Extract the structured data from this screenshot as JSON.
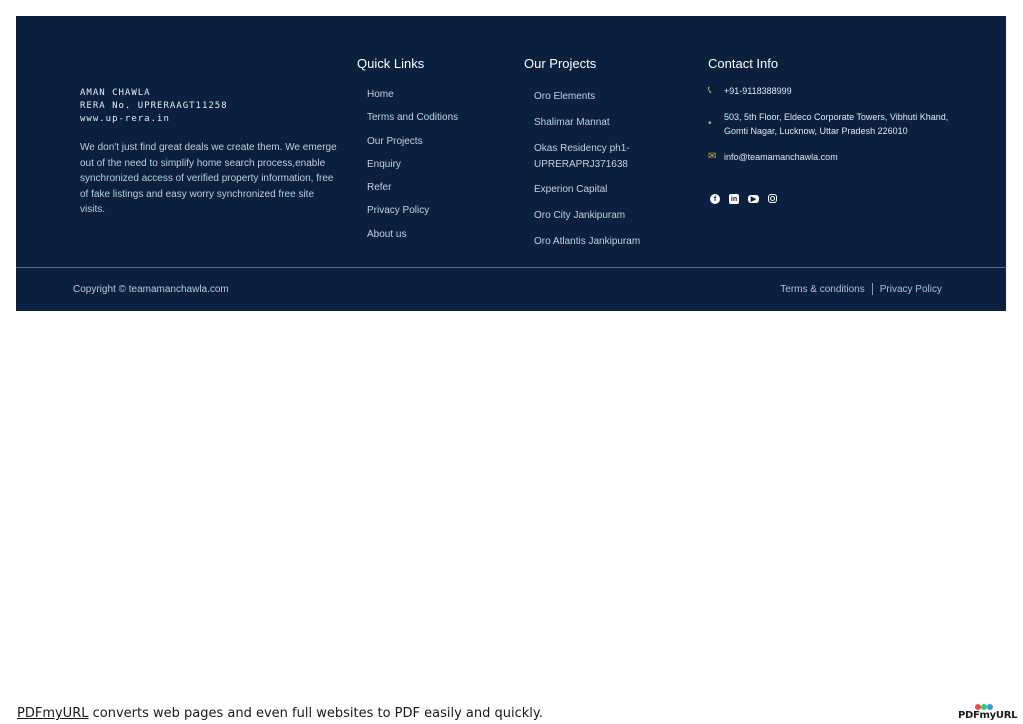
{
  "about": {
    "name": "AMAN CHAWLA",
    "rera": "RERA No. UPRERAAGT11258",
    "website": "www.up-rera.in",
    "description": "We don't just find great deals we create them. We emerge out of the need to simplify home search process,enable synchronized access of verified property information, free of fake listings and easy worry synchronized free site visits."
  },
  "quick_links": {
    "title": "Quick Links",
    "items": [
      "Home",
      "Terms and Coditions",
      "Our Projects",
      "Enquiry",
      "Refer",
      "Privacy Policy",
      "About us"
    ]
  },
  "projects": {
    "title": "Our Projects",
    "items": [
      "Oro Elements",
      "Shalimar Mannat",
      "Okas Residency ph1- UPRERAPRJ371638",
      "Experion Capital",
      "Oro City Jankipuram",
      "Oro Atlantis Jankipuram"
    ]
  },
  "contact": {
    "title": "Contact Info",
    "phone": "+91-9118388999",
    "address": "503, 5th Floor, Eldeco Corporate Towers, Vibhuti Khand, Gomti Nagar, Lucknow, Uttar Pradesh 226010",
    "email": "info@teamamanchawla.com",
    "icons": {
      "phone": "phone-icon",
      "address": "map-pin-icon",
      "email": "envelope-icon"
    },
    "social": [
      "facebook-icon",
      "linkedin-icon",
      "youtube-icon",
      "instagram-icon"
    ]
  },
  "bottom": {
    "copyright": "Copyright © teamamanchawla.com",
    "terms": "Terms & conditions",
    "privacy": "Privacy Policy"
  },
  "pdf_note": {
    "link": "PDFmyURL",
    "text": " converts web pages and even full websites to PDF easily and quickly.",
    "logo": "PDFmyURL"
  },
  "colors": {
    "footer_bg": "#0b1f3f",
    "accent": "#d4a843",
    "divider": "#5a6a85"
  }
}
